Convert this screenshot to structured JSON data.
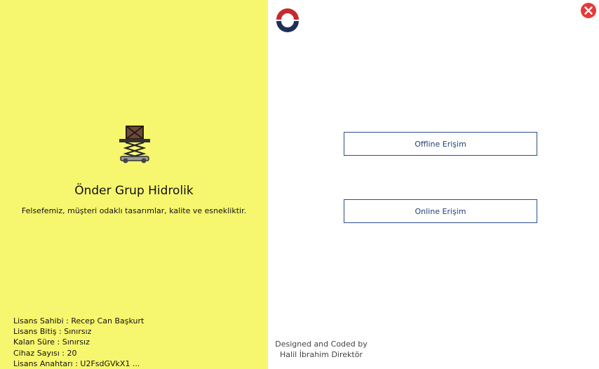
{
  "app": {
    "title": "Önder Grup Hidrolik",
    "tagline": "Felsefemiz, müşteri odaklı tasarımlar, kalite ve esnekliktir.",
    "icon": "scissor-lift-icon"
  },
  "license": {
    "owner": "Lisans Sahibi : Recep Can Başkurt",
    "expiry": "Lisans Bitiş : Sınırsız",
    "remaining": "Kalan Süre : Sınırsız",
    "device_count": "Cihaz Sayısı : 20",
    "key": "Lisans Anahtarı : U2FsdGVkX1 ..."
  },
  "actions": {
    "offline_label": "Offline Erişim",
    "online_label": "Online Erişim"
  },
  "credits": {
    "line1": "Designed and Coded by",
    "line2": "Halil İbrahim Direktör"
  },
  "icons": {
    "brand_logo": "brand-logo-icon",
    "close": "close-icon"
  },
  "colors": {
    "left_panel_bg": "#f7f76f",
    "button_border": "#2b4f8a",
    "close_red": "#e23b3b",
    "logo_red": "#c8282e",
    "logo_navy": "#1f2f55"
  }
}
